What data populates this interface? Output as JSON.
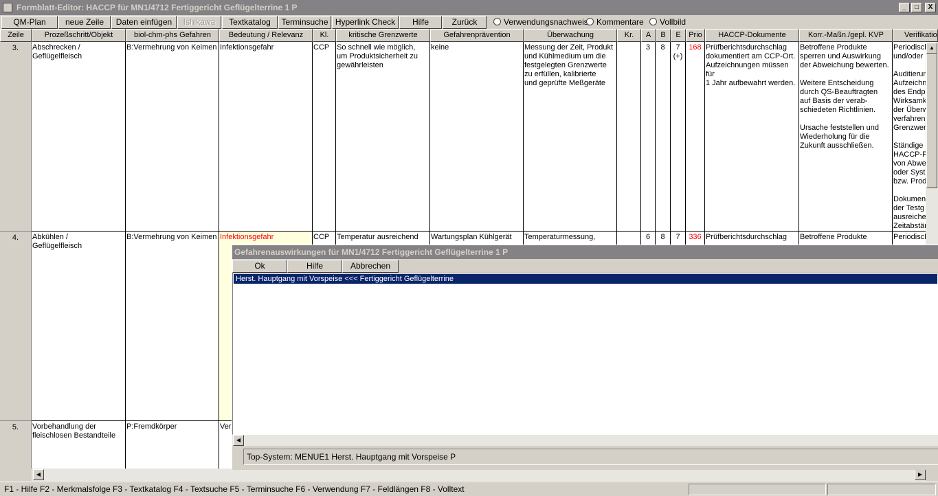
{
  "window": {
    "title": "Formblatt-Editor: HACCP für MN1/4712  Fertiggericht Geflügelterrine  1  P",
    "controls": {
      "minimize": "_",
      "maximize": "□",
      "close": "X"
    }
  },
  "toolbar": {
    "qm_plan": "QM-Plan",
    "neue_zeile": "neue Zeile",
    "daten_einfuegen": "Daten einfügen",
    "ishikawa": "Ishikawa",
    "textkatalog": "Textkatalog",
    "terminsuche": "Terminsuche",
    "hyperlink_check": "Hyperlink Check",
    "hilfe": "Hilfe",
    "zurueck": "Zurück",
    "radio_verwendungsnachweis": "Verwendungsnachweis",
    "radio_kommentare": "Kommentare",
    "radio_vollbild": "Vollbild"
  },
  "columns": {
    "zeile": "Zeile",
    "prozessschritt": "Prozeßschritt/Objekt",
    "gefahren": "biol-chm-phs Gefahren",
    "bedeutung": "Bedeutung / Relevanz",
    "kl": "Kl.",
    "grenzwerte": "kritische Grenzwerte",
    "praevention": "Gefahrenprävention",
    "ueberwachung": "Überwachung",
    "kr": "Kr.",
    "a": "A",
    "b": "B",
    "e": "E",
    "prio": "Prio",
    "dokumente": "HACCP-Dokumente",
    "korr": "Korr.-Maßn./gepl. KVP",
    "verifikation": "Verifikatio"
  },
  "rows": [
    {
      "zeile": "3.",
      "prozessschritt": "Abschrecken /\nGeflügelfleisch",
      "gefahren": "B:Vermehrung von Keimen",
      "bedeutung": "Infektionsgefahr",
      "kl": "CCP",
      "grenzwerte": "So schnell wie möglich,\num Produktsicherheit zu\ngewährleisten",
      "praevention": "keine",
      "ueberwachung": "Messung der Zeit, Produkt\nund Kühlmedium um die\nfestgelegten Grenzwerte\nzu erfüllen, kalibrierte\nund geprüfte Meßgeräte",
      "kr": "",
      "a": "3",
      "b": "8",
      "e": "7\n(+)",
      "prio": "168",
      "dokumente": "Prüfberichtsdurchschlag\ndokumentiert am CCP-Ort.\nAufzeichnungen müssen für\n1 Jahr aufbewahrt werden.",
      "korr": "Betroffene Produkte\nsperren und Auswirkung\nder Abweichung bewerten.\n\nWeitere Entscheidung\ndurch QS-Beauftragten\nauf Basis der verab-\nschiedeten Richtlinien.\n\nUrsache feststellen und\nWiederholung für die\nZukunft ausschließen.",
      "verifikation": "Periodisch\nund/oder\n\nAuditierun\nAufzeichn\ndes Endpr\nWirksamk\nder Überw\nverfahren\nGrenzwert\n\nStändige\nHACCP-P\nvon Abwe\noder Syste\nbzw. Prod\n\nDokumen\nder Testg\nausreiche\nZeitabstän"
    },
    {
      "zeile": "4.",
      "prozessschritt": "Abkühlen /\nGeflügelfleisch",
      "gefahren": "B:Vermehrung von Keimen",
      "bedeutung": "Infektionsgefahr",
      "kl": "CCP",
      "grenzwerte": "Temperatur ausreichend",
      "praevention": "Wartungsplan Kühlgerät",
      "ueberwachung": "Temperaturmessung,",
      "kr": "",
      "a": "6",
      "b": "8",
      "e": "7",
      "prio": "336",
      "dokumente": "Prüfberichtsdurchschlag",
      "korr": "Betroffene Produkte",
      "verifikation": "Periodisch"
    },
    {
      "zeile": "5.",
      "prozessschritt": "Vorbehandlung der\nfleischlosen Bestandteile",
      "gefahren": "P:Fremdkörper",
      "bedeutung": "Ver",
      "kl": "",
      "grenzwerte": "",
      "praevention": "",
      "ueberwachung": "",
      "kr": "",
      "a": "",
      "b": "",
      "e": "",
      "prio": "",
      "dokumente": "",
      "korr": "",
      "verifikation": ""
    }
  ],
  "dialog": {
    "title": "Gefahrenauswirkungen für MN1/4712  Fertiggericht Geflügelterrine  1  P",
    "ok": "Ok",
    "hilfe": "Hilfe",
    "abbrechen": "Abbrechen",
    "selected_item": "Herst. Hauptgang mit Vorspeise <<< Fertiggericht Geflügelterrine",
    "status": "Top-System: MENUE1    Herst. Hauptgang mit Vorspeise  P"
  },
  "statusbar": {
    "text": "F1 - Hilfe  F2 - Merkmalsfolge  F3 - Textkatalog  F4 - Textsuche  F5 - Terminsuche  F6 - Verwendung  F7 - Feldlängen  F8 - Volltext"
  },
  "colors": {
    "titlebar_inactive": "#848284",
    "face": "#d4d0c8",
    "selection": "#0a246a",
    "prio_red": "#ff0000",
    "highlight_yellow": "#ffffe0"
  }
}
